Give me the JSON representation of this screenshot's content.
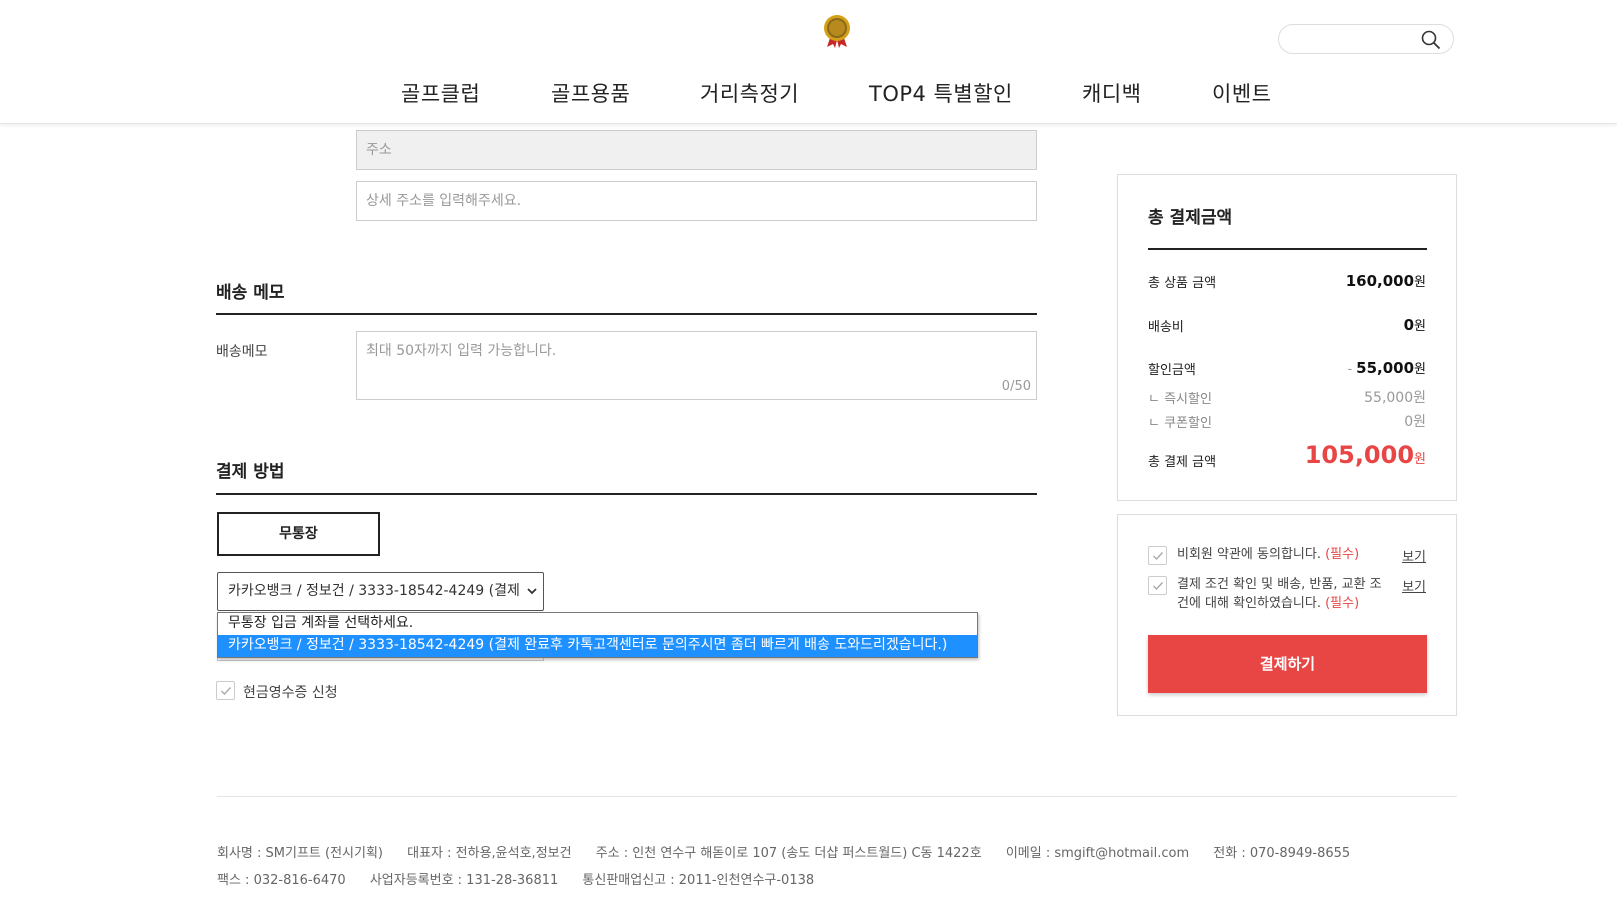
{
  "header": {
    "logo_icon": "gold-badge-logo-icon",
    "search": {
      "placeholder": "",
      "icon": "search-icon"
    },
    "nav": [
      {
        "label": "골프클럽"
      },
      {
        "label": "골프용품"
      },
      {
        "label": "거리측정기"
      },
      {
        "label": "TOP4 특별할인"
      },
      {
        "label": "캐디백"
      },
      {
        "label": "이벤트"
      }
    ]
  },
  "address": {
    "address_placeholder": "주소",
    "detail_placeholder": "상세 주소를 입력해주세요."
  },
  "delivery_memo": {
    "section_title": "배송 메모",
    "label": "배송메모",
    "placeholder": "최대 50자까지 입력 가능합니다.",
    "counter": "0/50"
  },
  "payment": {
    "section_title": "결제 방법",
    "tab_label": "무통장",
    "selected_value": "카카오뱅크 / 정보건 / 3333-18542-4249 (결제",
    "options": [
      "무통장 입금 계좌를 선택하세요.",
      "카카오뱅크 / 정보건 / 3333-18542-4249 (결제 완료후 카톡고객센터로 문의주시면 좀더 빠르게 배송 도와드리겠습니다.)"
    ],
    "cash_receipt_label": "현금영수증 신청"
  },
  "summary": {
    "title": "총 결제금액",
    "product_label": "총 상품 금액",
    "product_value": "160,000",
    "shipping_label": "배송비",
    "shipping_value": "0",
    "discount_label": "할인금액",
    "discount_minus": "-",
    "discount_value": "55,000",
    "instant_label": "ㄴ 즉시할인",
    "instant_value": "55,000원",
    "coupon_label": "ㄴ 쿠폰할인",
    "coupon_value": "0원",
    "total_label": "총 결제 금액",
    "total_value": "105,000",
    "currency": "원"
  },
  "agreements": {
    "terms_text": "비회원 약관에 동의합니다.",
    "terms_required": "(필수)",
    "terms_view": "보기",
    "conditions_text": "결제 조건 확인 및 배송, 반품, 교환 조건에 대해 확인하였습니다.",
    "conditions_required": "(필수)",
    "conditions_view": "보기",
    "pay_button": "결제하기"
  },
  "footer": {
    "company": "회사명 : SM기프트 (전시기획)",
    "ceo": "대표자 : 전하용,윤석호,정보건",
    "address": "주소 : 인천 연수구 해돋이로 107 (송도 더샵 퍼스트월드) C동 1422호",
    "email": "이메일 : smgift@hotmail.com",
    "phone": "전화 : 070-8949-8655",
    "fax": "팩스 : 032-816-6470",
    "business_no": "사업자등록번호 : 131-28-36811",
    "mail_order": "통신판매업신고 : 2011-인천연수구-0138"
  },
  "colors": {
    "accent": "#e84545",
    "select_highlight": "#1e90ff"
  }
}
